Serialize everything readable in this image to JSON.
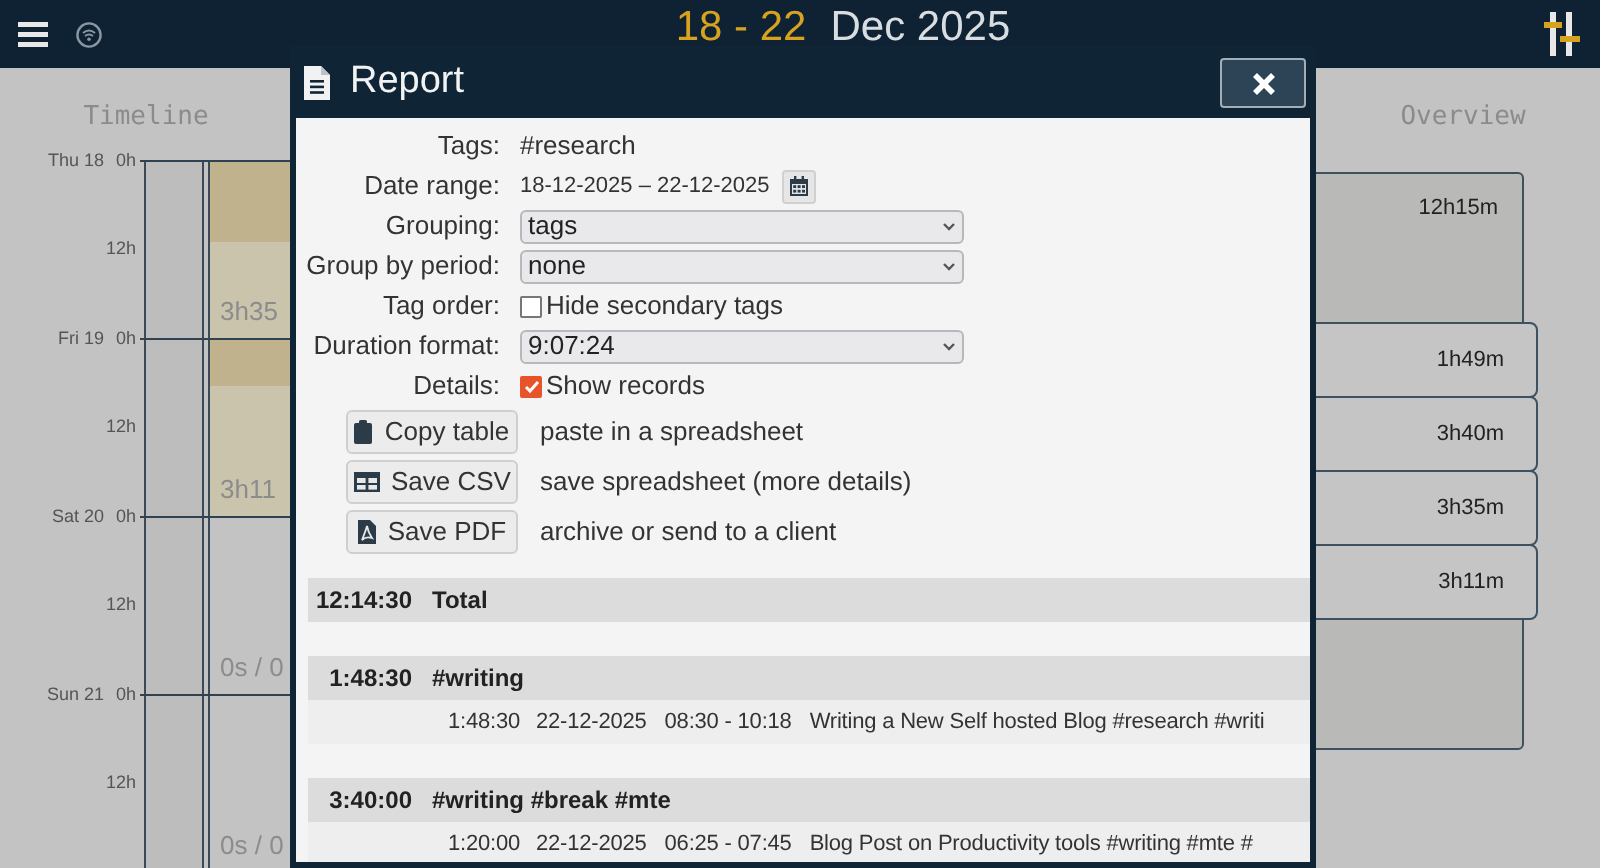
{
  "top_bar": {
    "date_range": "18 - 22",
    "month": "Dec 2025"
  },
  "timeline": {
    "title": "Timeline",
    "days": [
      {
        "day": "Thu 18",
        "start": "0h",
        "mid": "12h",
        "summary": "3h35",
        "tracked": true
      },
      {
        "day": "Fri 19",
        "start": "0h",
        "mid": "12h",
        "summary": "3h11",
        "tracked": true
      },
      {
        "day": "Sat 20",
        "start": "0h",
        "mid": "12h",
        "summary": "0s / 0",
        "tracked": false
      },
      {
        "day": "Sun 21",
        "start": "0h",
        "mid": "12h",
        "summary": "0s / 0",
        "tracked": false
      }
    ]
  },
  "overview": {
    "title": "Overview",
    "total": "12h15m",
    "days": [
      "1h49m",
      "3h40m",
      "3h35m",
      "3h11m"
    ]
  },
  "dialog": {
    "title": "Report",
    "fields": [
      {
        "label": "Tags:",
        "kind": "text",
        "value": "#research"
      },
      {
        "label": "Date range:",
        "kind": "date",
        "value": "18-12-2025 – 22-12-2025"
      },
      {
        "label": "Grouping:",
        "kind": "select",
        "value": "tags"
      },
      {
        "label": "Group by period:",
        "kind": "select",
        "value": "none"
      },
      {
        "label": "Tag order:",
        "kind": "checkbox",
        "text": "Hide secondary tags",
        "checked": false
      },
      {
        "label": "Duration format:",
        "kind": "select",
        "value": "9:07:24"
      },
      {
        "label": "Details:",
        "kind": "checkbox",
        "text": "Show records",
        "checked": true
      }
    ],
    "actions": [
      {
        "label": "Copy table",
        "hint": "paste in a spreadsheet"
      },
      {
        "label": "Save CSV",
        "hint": "save spreadsheet (more details)"
      },
      {
        "label": "Save PDF",
        "hint": "archive or send to a client"
      }
    ],
    "report": [
      {
        "duration": "12:14:30",
        "tags": "Total"
      },
      {
        "duration": "1:48:30",
        "tags": "#writing",
        "records": [
          {
            "duration": "1:48:30",
            "date": "22-12-2025",
            "time": "08:30 - 10:18",
            "description": "Writing a New Self hosted Blog #research #writi"
          }
        ]
      },
      {
        "duration": "3:40:00",
        "tags": "#writing #break #mte",
        "records": [
          {
            "duration": "1:20:00",
            "date": "22-12-2025",
            "time": "06:25 - 07:45",
            "description": "Blog Post on Productivity tools #writing #mte #"
          }
        ]
      }
    ]
  }
}
